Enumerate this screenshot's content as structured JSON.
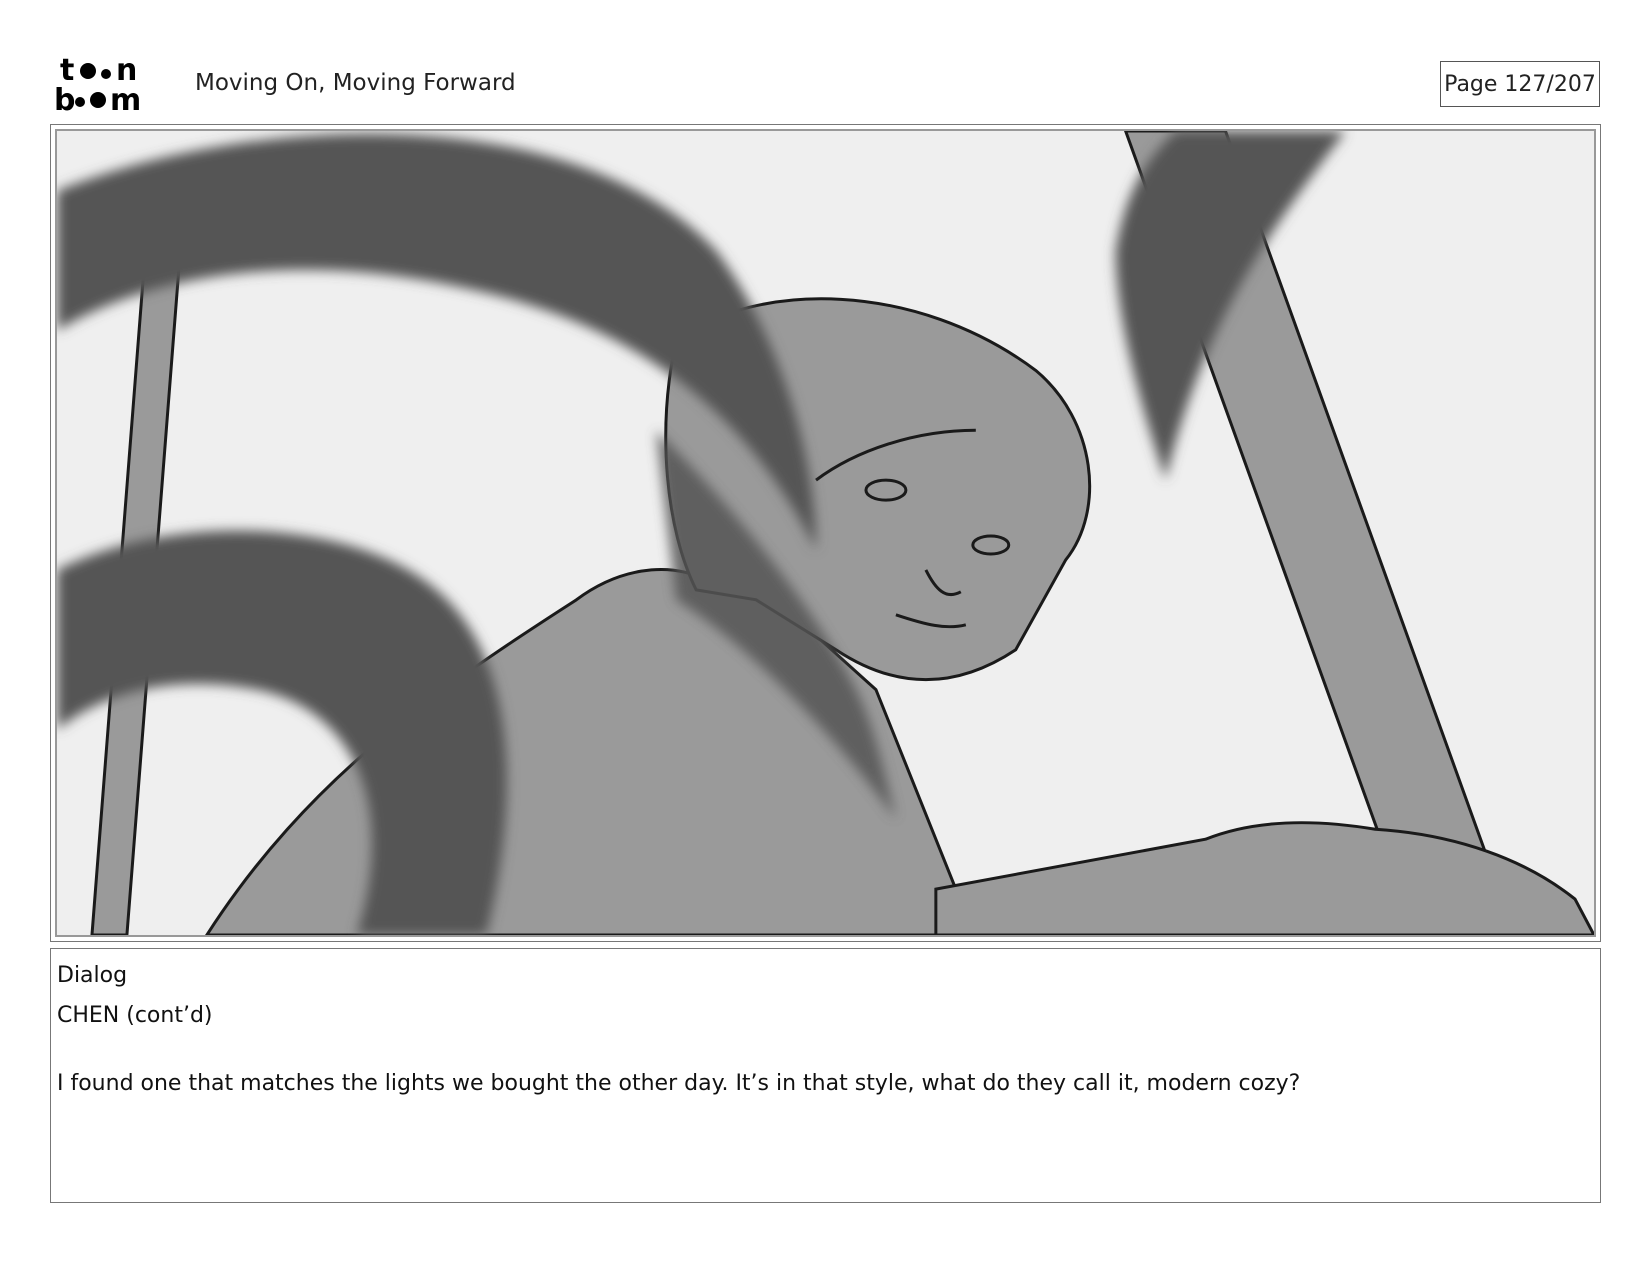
{
  "header": {
    "logo_text": "toon boom",
    "title": "Moving On, Moving Forward",
    "page_label": "Page 127/207"
  },
  "panel": {
    "icon": "storyboard-sketch"
  },
  "dialog": {
    "label": "Dialog",
    "speaker": "CHEN (cont’d)",
    "line": "I found one that matches the lights we bought the other day. It’s in that style, what do they call it, modern cozy?"
  },
  "colors": {
    "background": "#efefef",
    "mid_gray": "#9a9a9a",
    "dark_gray": "#555555",
    "line": "#1a1a1a"
  }
}
